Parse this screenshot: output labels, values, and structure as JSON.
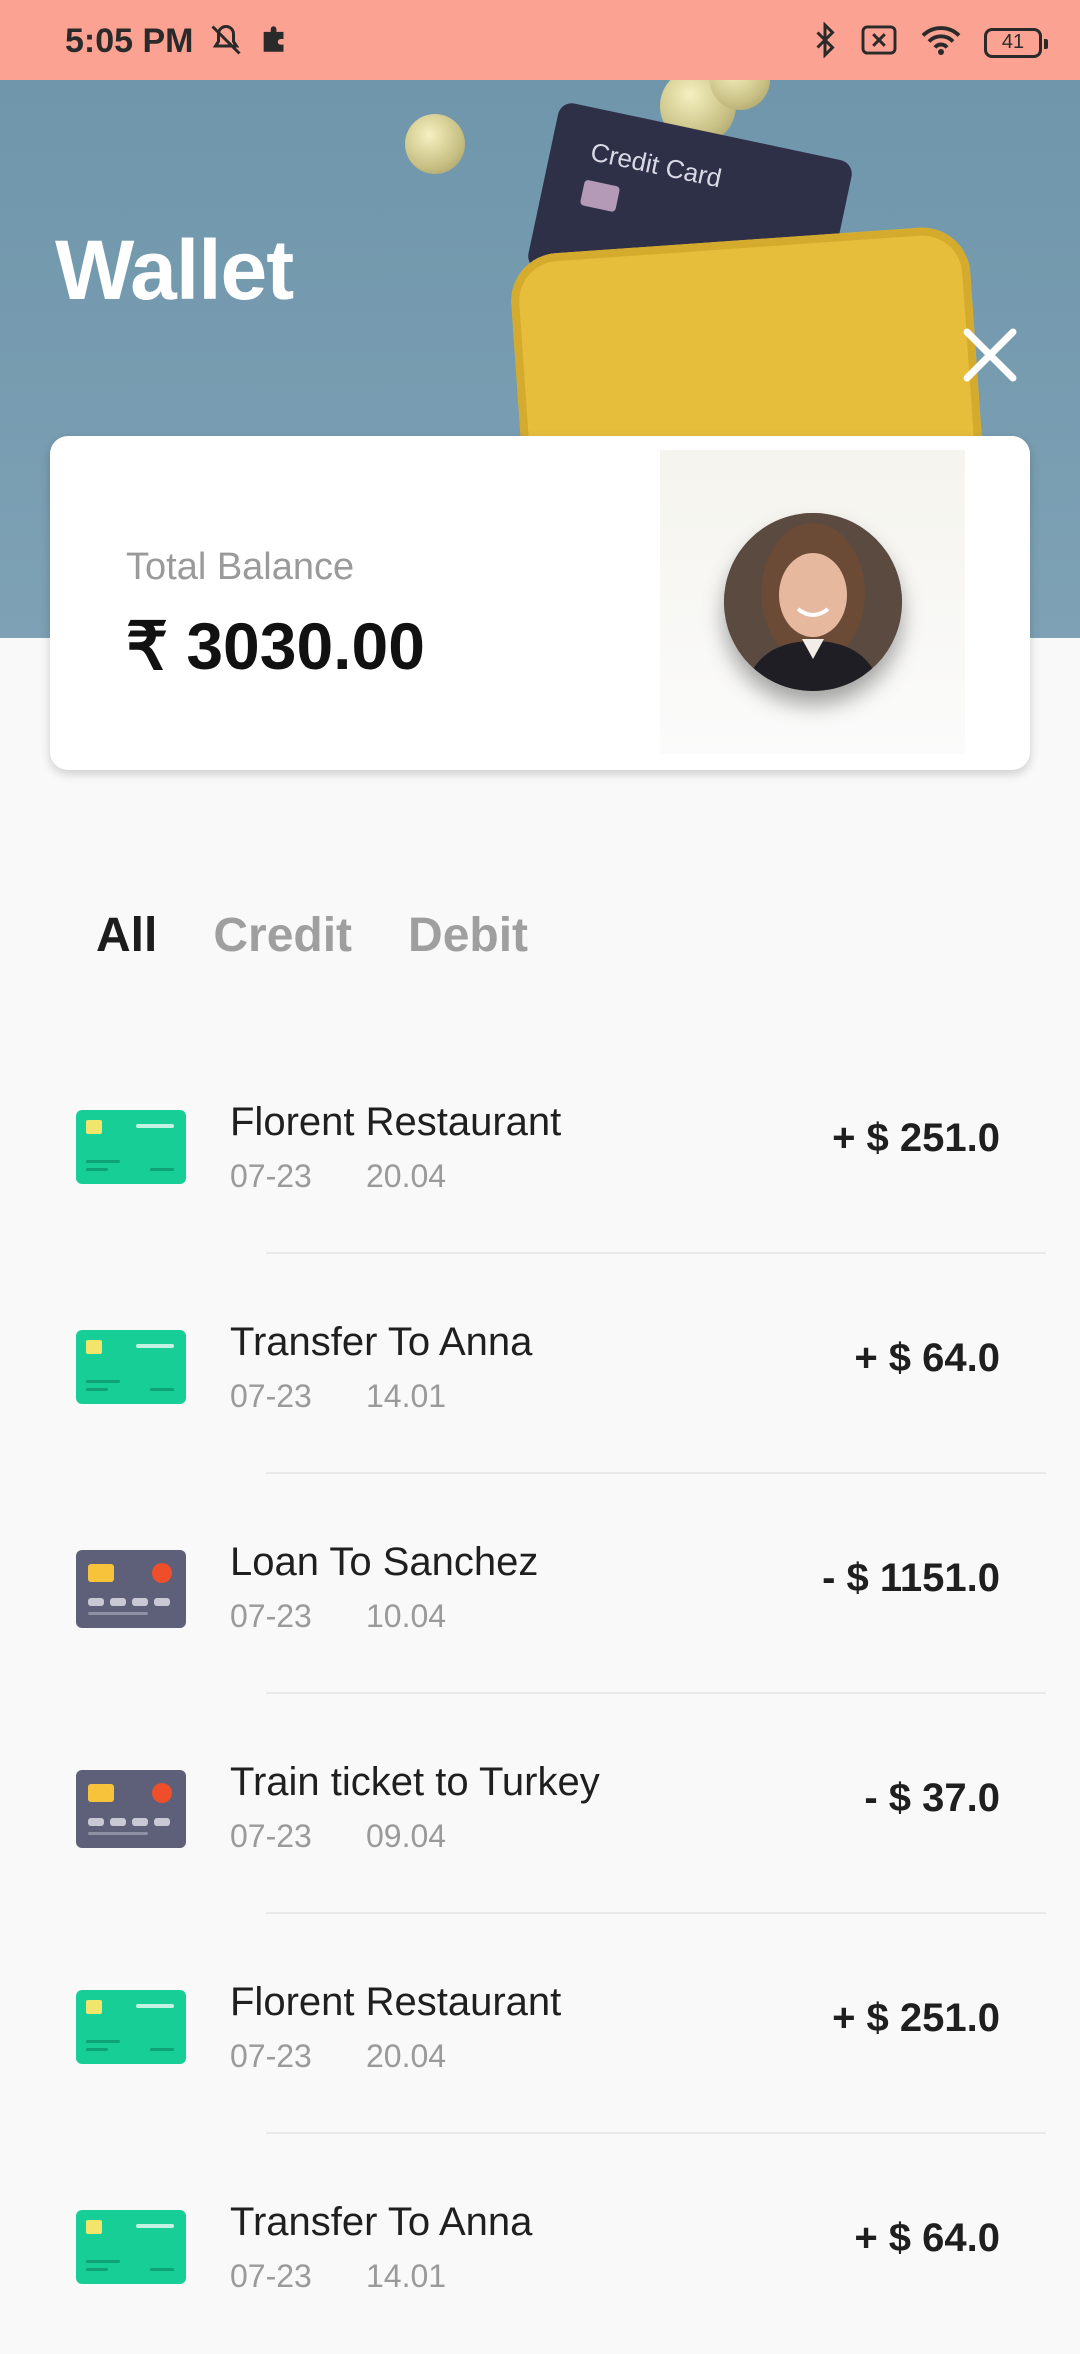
{
  "status_bar": {
    "time": "5:05 PM",
    "battery": "41",
    "icons": [
      "mute-icon",
      "puzzle-icon",
      "bluetooth-icon",
      "sim-off-icon",
      "wifi-icon",
      "battery-icon"
    ]
  },
  "header": {
    "title": "Wallet",
    "photo_card_label": "Credit Card",
    "close_icon": "close-icon"
  },
  "balance": {
    "label": "Total Balance",
    "value": "₹ 3030.00"
  },
  "tabs": [
    {
      "label": "All",
      "active": true
    },
    {
      "label": "Credit",
      "active": false
    },
    {
      "label": "Debit",
      "active": false
    }
  ],
  "transactions": [
    {
      "title": "Florent Restaurant",
      "date": "07-23",
      "time": "20.04",
      "amount": "+ $ 251.0",
      "type": "credit"
    },
    {
      "title": "Transfer To Anna",
      "date": "07-23",
      "time": "14.01",
      "amount": "+ $ 64.0",
      "type": "credit"
    },
    {
      "title": "Loan To Sanchez",
      "date": "07-23",
      "time": "10.04",
      "amount": "- $ 1151.0",
      "type": "debit"
    },
    {
      "title": "Train ticket to Turkey",
      "date": "07-23",
      "time": "09.04",
      "amount": "- $ 37.0",
      "type": "debit"
    },
    {
      "title": "Florent Restaurant",
      "date": "07-23",
      "time": "20.04",
      "amount": "+ $ 251.0",
      "type": "credit"
    },
    {
      "title": "Transfer To Anna",
      "date": "07-23",
      "time": "14.01",
      "amount": "+ $ 64.0",
      "type": "credit"
    }
  ],
  "colors": {
    "status_bar": "#fca293",
    "header": "#7ea1b5",
    "credit_card_icon": "#17cf96",
    "debit_card_icon": "#5d6078",
    "chip_yellow": "#f6c33b",
    "debit_dot": "#ef4e2a"
  }
}
